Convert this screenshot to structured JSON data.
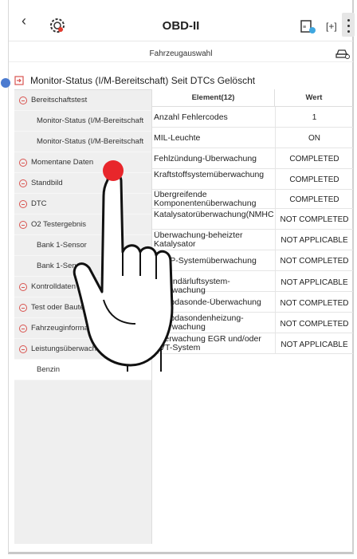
{
  "header": {
    "title": "OBD-II",
    "back_icon": "chevron-left-icon",
    "logo_icon": "gear-logo-icon",
    "icons": [
      "vci-icon",
      "screenshot-icon",
      "more-icon"
    ],
    "screenshot_label": "[+]"
  },
  "subbar": {
    "label": "Fahrzeugauswahl",
    "icon": "car-icon"
  },
  "page_heading": "Monitor-Status (I/M-Bereitschaft) Seit DTCs Gelöscht",
  "left_menu": [
    {
      "label": "Bereitschaftstest",
      "type": "group"
    },
    {
      "label": "Monitor-Status (I/M-Bereitschaft",
      "type": "sub"
    },
    {
      "label": "Monitor-Status (I/M-Bereitschaft",
      "type": "sub"
    },
    {
      "label": "Momentane Daten",
      "type": "group"
    },
    {
      "label": "Standbild",
      "type": "group"
    },
    {
      "label": "DTC",
      "type": "group"
    },
    {
      "label": "O2 Testergebnis",
      "type": "group"
    },
    {
      "label": "Bank 1-Sensor",
      "type": "sub"
    },
    {
      "label": "Bank 1-Sensor",
      "type": "sub"
    },
    {
      "label": "Kontrolldaten",
      "type": "group"
    },
    {
      "label": "Test oder Bauteil",
      "type": "group"
    },
    {
      "label": "Fahrzeuginformation",
      "type": "group"
    },
    {
      "label": "Leistungsüberwachung",
      "type": "group"
    },
    {
      "label": "Benzin",
      "type": "sub",
      "selected": true
    }
  ],
  "table": {
    "headers": [
      "Element(12)",
      "Wert"
    ],
    "rows": [
      {
        "element": "Anzahl Fehlercodes",
        "value": "1"
      },
      {
        "element": "MIL-Leuchte",
        "value": "ON"
      },
      {
        "element": "Fehlzündung-Überwachung",
        "value": "COMPLETED"
      },
      {
        "element": "Kraftstoffsystemüberwachung",
        "value": "COMPLETED"
      },
      {
        "element": "Übergreifende Komponentenüberwachung",
        "value": "COMPLETED"
      },
      {
        "element": "Katalysatorüberwachung(NMHC)",
        "value": "NOT COMPLETED"
      },
      {
        "element": "Überwachung-beheizter Katalysator",
        "value": "NOT APPLICABLE"
      },
      {
        "element": "EVAP-Systemüberwachung",
        "value": "NOT COMPLETED"
      },
      {
        "element": "Sekundärluftsystem-Überwachung",
        "value": "NOT APPLICABLE"
      },
      {
        "element": "Lambdasonde-Überwachung",
        "value": "NOT COMPLETED"
      },
      {
        "element": "Lambdasondenheizung-Überwachung",
        "value": "NOT COMPLETED"
      },
      {
        "element": "Überwachung EGR und/oder VVT-System",
        "value": "NOT APPLICABLE"
      }
    ]
  },
  "colors": {
    "accent_red": "#d9534f",
    "touch_dot": "#e8262b",
    "cursor_dot": "#4b7bd0"
  }
}
